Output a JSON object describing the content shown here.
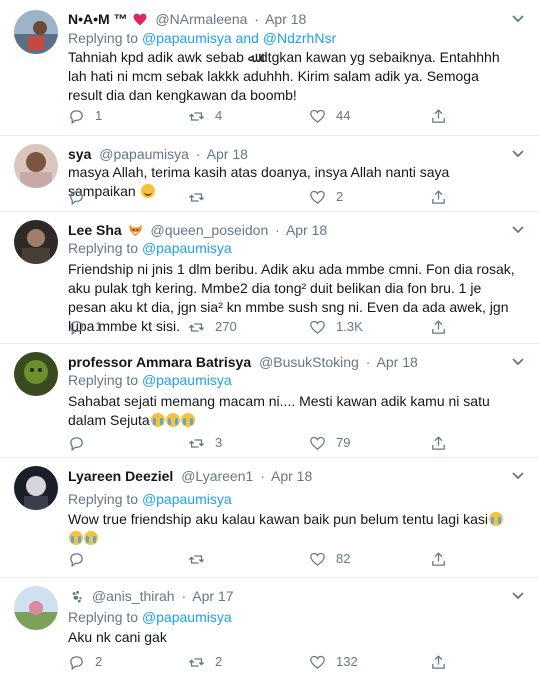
{
  "tweets": [
    {
      "name": "N•A•M ™",
      "handle": "@NArmaleena",
      "date": "Apr 18",
      "reply_prefix": "Replying to ",
      "reply_users": "@papaumisya and @NdzrhNsr",
      "text": "Tahniah kpd adik awk sebab ﷲ dtgkan kawan yg sebaiknya. Entahhhh lah hati ni mcm sebak lakkk aduhhh. Kirim salam adik ya. Semoga result dia dan kengkawan da boomb!",
      "emoji_after": "",
      "counts": {
        "reply": "1",
        "retweet": "4",
        "like": "44"
      }
    },
    {
      "name": "sya",
      "handle": "@papaumisya",
      "date": "Apr 18",
      "reply_prefix": "",
      "reply_users": "",
      "text": "masya Allah, terima kasih atas doanya, insya Allah nanti saya sampaikan",
      "emoji_after": "smile",
      "counts": {
        "reply": "",
        "retweet": "",
        "like": "2"
      }
    },
    {
      "name": "Lee Sha",
      "handle": "@queen_poseidon",
      "date": "Apr 18",
      "reply_prefix": "Replying to ",
      "reply_users": "@papaumisya",
      "text": "Friendship ni jnis 1 dlm beribu. Adik aku ada mmbe cmni. Fon dia rosak, aku pulak tgh kering. Mmbe2 dia tong² duit belikan dia fon bru. 1 je pesan aku kt dia, jgn sia² kn mmbe sush sng ni. Even da ada awek, jgn lupa mmbe kt sisi.",
      "emoji_after": "",
      "counts": {
        "reply": "1",
        "retweet": "270",
        "like": "1.3K"
      }
    },
    {
      "name": "professor Ammara Batrisya",
      "handle": "@BusukStoking",
      "date": "Apr 18",
      "reply_prefix": "Replying to ",
      "reply_users": "@papaumisya",
      "text": "Sahabat sejati memang macam ni.... Mesti kawan adik kamu ni satu dalam Sejuta",
      "emoji_after": "cry3",
      "counts": {
        "reply": "",
        "retweet": "3",
        "like": "79"
      }
    },
    {
      "name": "Lyareen Deeziel",
      "handle": "@Lyareen1",
      "date": "Apr 18",
      "reply_prefix": "Replying to ",
      "reply_users": "@papaumisya",
      "text": "Wow true friendship aku kalau kawan baik pun belum tentu lagi kasi",
      "emoji_after": "cry3",
      "counts": {
        "reply": "",
        "retweet": "",
        "like": "82"
      }
    },
    {
      "name": "",
      "handle": "@anis_thirah",
      "date": "Apr 17",
      "reply_prefix": "Replying to ",
      "reply_users": "@papaumisya",
      "text": "Aku nk cani gak",
      "emoji_after": "",
      "counts": {
        "reply": "2",
        "retweet": "2",
        "like": "132"
      }
    }
  ],
  "colors": {
    "text": "#14171a",
    "muted": "#657786",
    "link": "#1da1f2",
    "border": "#e6ecf0",
    "heart": "#e0245e"
  },
  "icons": [
    "reply-icon",
    "retweet-icon",
    "like-icon",
    "share-icon",
    "caret-down-icon"
  ]
}
